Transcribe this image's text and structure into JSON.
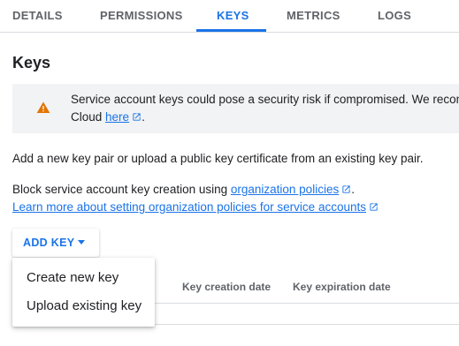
{
  "tabs": [
    {
      "label": "DETAILS"
    },
    {
      "label": "PERMISSIONS"
    },
    {
      "label": "KEYS",
      "active": true
    },
    {
      "label": "METRICS"
    },
    {
      "label": "LOGS"
    }
  ],
  "page_title": "Keys",
  "warning": {
    "icon": "warning-icon",
    "line1": "Service account keys could pose a security risk if compromised. We recomm",
    "line2_prefix": "Cloud ",
    "link_text": "here",
    "line2_suffix": "."
  },
  "description": "Add a new key pair or upload a public key certificate from an existing key pair.",
  "policy": {
    "prefix": "Block service account key creation using ",
    "link_text": "organization policies",
    "suffix": ".",
    "learn_more": "Learn more about setting organization policies for service accounts"
  },
  "add_key_button": {
    "label": "ADD KEY",
    "icon": "caret-down-icon"
  },
  "table": {
    "columns": [
      "Key creation date",
      "Key expiration date"
    ]
  },
  "menu": {
    "items": [
      {
        "label": "Create new key"
      },
      {
        "label": "Upload existing key"
      }
    ]
  },
  "colors": {
    "accent": "#1a73e8",
    "warning": "#e37400",
    "banner_bg": "#f1f3f4"
  }
}
